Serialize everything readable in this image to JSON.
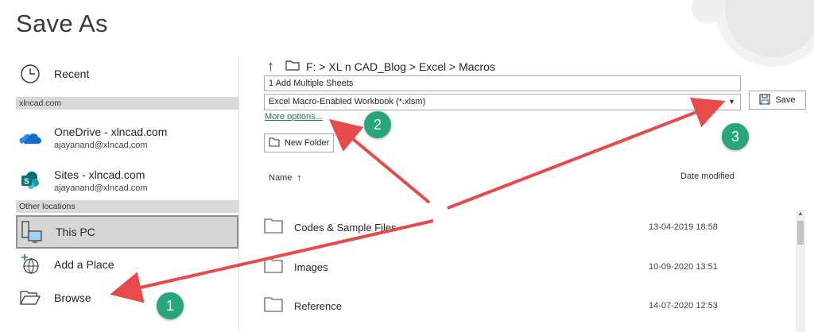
{
  "page_title": "Save As",
  "nav": {
    "recent_label": "Recent",
    "header_account": "xlncad.com",
    "onedrive_label": "OneDrive - xlncad.com",
    "onedrive_email": "ajayanand@xlncad.com",
    "sites_label": "Sites - xlncad.com",
    "sites_email": "ajayanand@xlncad.com",
    "header_other": "Other locations",
    "thispc_label": "This PC",
    "addplace_label": "Add a Place",
    "browse_label": "Browse"
  },
  "breadcrumb": {
    "path": "F: > XL n CAD_Blog > Excel > Macros"
  },
  "file_name": "1 Add Multiple Sheets",
  "file_type": "Excel Macro-Enabled Workbook (*.xlsm)",
  "save_label": "Save",
  "more_options_label": "More options...",
  "new_folder_label": "New Folder",
  "columns": {
    "name": "Name",
    "date": "Date modified"
  },
  "files": [
    {
      "name": "Codes & Sample Files",
      "date": "13-04-2019 18:58"
    },
    {
      "name": "Images",
      "date": "10-09-2020 13:51"
    },
    {
      "name": "Reference",
      "date": "14-07-2020 12:53"
    }
  ],
  "badges": {
    "one": "1",
    "two": "2",
    "three": "3"
  },
  "colors": {
    "accent_green": "#217346",
    "badge_green": "#27a67b",
    "arrow_red": "#e84a4a"
  }
}
